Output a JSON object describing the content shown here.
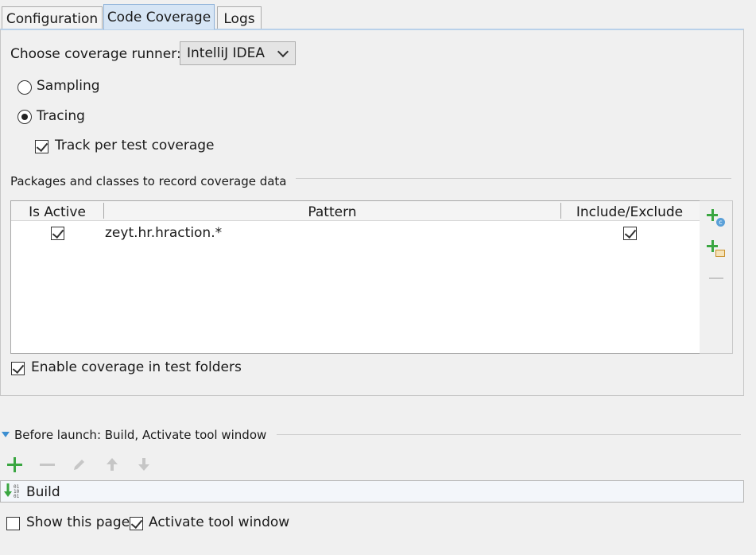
{
  "tabs": [
    {
      "label": "Configuration"
    },
    {
      "label": "Code Coverage"
    },
    {
      "label": "Logs"
    }
  ],
  "runner": {
    "label": "Choose coverage runner:",
    "value": "IntelliJ IDEA"
  },
  "modes": {
    "sampling": "Sampling",
    "tracing": "Tracing",
    "selected": "tracing"
  },
  "track_per_test": {
    "label": "Track per test coverage",
    "checked": true
  },
  "packages": {
    "section_title": "Packages and classes to record coverage data",
    "columns": [
      "Is Active",
      "Pattern",
      "Include/Exclude"
    ],
    "rows": [
      {
        "active": true,
        "pattern": "zeyt.hr.hraction.*",
        "include": true
      }
    ]
  },
  "sidebar_icons": [
    "add-class-icon",
    "add-package-icon",
    "remove-icon"
  ],
  "enable_test_folders": {
    "label": "Enable coverage in test folders",
    "checked": true
  },
  "before_launch": {
    "title": "Before launch: Build, Activate tool window",
    "toolbar": [
      "add-icon",
      "remove-icon",
      "edit-icon",
      "move-up-icon",
      "move-down-icon"
    ],
    "items": [
      {
        "label": "Build",
        "icon": "build-icon"
      }
    ]
  },
  "show_this_page": {
    "label": "Show this page",
    "checked": false
  },
  "activate_tool_window": {
    "label": "Activate tool window",
    "checked": true
  },
  "colors": {
    "accent": "#3aa641",
    "tab_active": "#d6e5f5",
    "triangle": "#3d8fd1"
  }
}
